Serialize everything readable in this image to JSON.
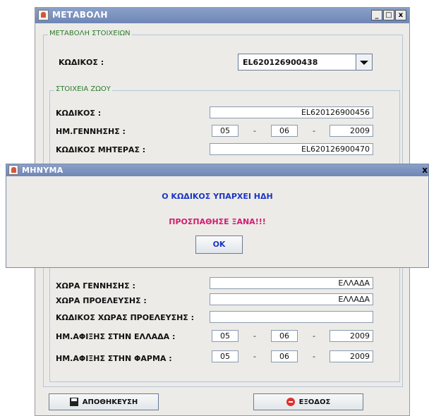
{
  "window": {
    "title": "ΜΕΤΑΒΟΛΗ",
    "min": "_",
    "max": "□",
    "close": "x"
  },
  "group_main": {
    "legend": "ΜΕΤΑΒΟΛΗ ΣΤΟΙΧΕΙΩΝ"
  },
  "code_select": {
    "label": "ΚΩΔΙΚΟΣ :",
    "value": "EL620126900438"
  },
  "group_animal": {
    "legend": "ΣΤΟΙΧΕΙΑ ΖΩΟΥ"
  },
  "animal": {
    "code_label": "ΚΩΔΙΚΟΣ :",
    "code_value": "EL620126900456",
    "birth_label": "ΗΜ.ΓΕΝΝΗΣΗΣ :",
    "birth_day": "05",
    "birth_month": "06",
    "birth_year": "2009",
    "mother_label": "ΚΩΔΙΚΟΣ ΜΗΤΕΡΑΣ :",
    "mother_value": "EL620126900470",
    "birth_country_label": "ΧΩΡΑ ΓΕΝΝΗΣΗΣ :",
    "birth_country_value": "ΕΛΛΑΔΑ",
    "origin_country_label": "ΧΩΡΑ ΠΡΟΕΛΕΥΣΗΣ :",
    "origin_country_value": "ΕΛΛΑΔΑ",
    "origin_code_label": "ΚΩΔΙΚΟΣ ΧΩΡΑΣ ΠΡΟΕΛΕΥΣΗΣ :",
    "origin_code_value": "",
    "arrival_gr_label": "ΗΜ.ΑΦΙΞΗΣ ΣΤΗΝ ΕΛΛΑΔΑ :",
    "arrival_gr_day": "05",
    "arrival_gr_month": "06",
    "arrival_gr_year": "2009",
    "arrival_farm_label": "ΗΜ.ΑΦΙΞΗΣ ΣΤΗΝ ΦΑΡΜΑ :",
    "arrival_farm_day": "05",
    "arrival_farm_month": "06",
    "arrival_farm_year": "2009",
    "dash": "-"
  },
  "buttons": {
    "save": "ΑΠΟΘΗΚΕΥΣΗ",
    "exit": "ΕΞΟΔΟΣ"
  },
  "dialog": {
    "title": "ΜΗΝΥΜΑ",
    "close": "x",
    "message": "Ο ΚΩΔΙΚΟΣ ΥΠΑΡΧΕΙ ΗΔΗ",
    "retry": "ΠΡΟΣΠΑΘΗΣΕ ΞΑΝΑ!!!",
    "ok": "OK"
  },
  "colors": {
    "message": "#1a36c4",
    "retry": "#d11d6f",
    "legend": "#2f7b2f"
  }
}
